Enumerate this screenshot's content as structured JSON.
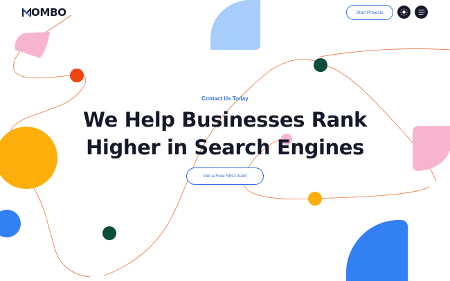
{
  "header": {
    "logo_text": "OMBO",
    "start_projects_label": "Start Projects",
    "theme_icon": "sun-icon",
    "menu_icon": "hamburger-icon"
  },
  "hero": {
    "eyebrow": "Contact Us Today",
    "headline_line1": "We Help Businesses Rank",
    "headline_line2": "Higher in Search Engines",
    "cta_label": "Get a Free SEO Audit"
  },
  "colors": {
    "brand_blue": "#2f6fe0",
    "dark": "#15192b",
    "orange_line": "#f0703a",
    "pink": "#f7b4d0",
    "light_blue": "#a7cdfb",
    "yellow": "#fdae0a",
    "red_orange": "#f0450f",
    "dark_green": "#0c4d3b",
    "bright_blue": "#3380f4"
  }
}
